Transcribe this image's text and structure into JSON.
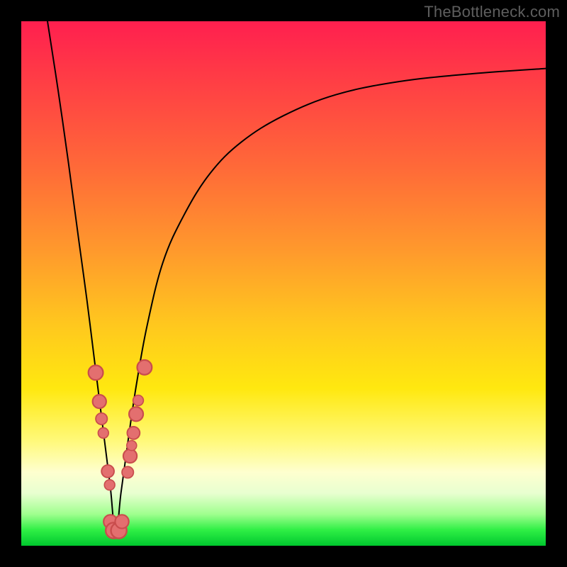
{
  "watermark": "TheBottleneck.com",
  "colors": {
    "frame": "#000000",
    "curve": "#000000",
    "bead_fill": "#e36f6f",
    "bead_stroke": "#c94d4d",
    "bead_stroke_wide": "#b94848"
  },
  "chart_data": {
    "type": "line",
    "title": "",
    "xlabel": "",
    "ylabel": "",
    "xlim": [
      0,
      100
    ],
    "ylim": [
      0,
      100
    ],
    "x_at_min": 18,
    "series": [
      {
        "name": "curve",
        "x": [
          5,
          7,
          9,
          11,
          12.5,
          14,
          15.5,
          17,
          18,
          19,
          20.5,
          22,
          24,
          27,
          31,
          36,
          42,
          50,
          60,
          72,
          86,
          100
        ],
        "y": [
          100,
          87,
          73,
          58,
          47,
          35,
          23,
          11,
          1.5,
          10,
          21,
          31,
          42,
          54,
          63,
          71,
          77,
          82,
          86,
          88.5,
          90,
          91
        ]
      }
    ],
    "beads": [
      {
        "x": 14.2,
        "y": 33,
        "r": 1.4
      },
      {
        "x": 14.9,
        "y": 27.5,
        "r": 1.3
      },
      {
        "x": 15.3,
        "y": 24.2,
        "r": 1.1
      },
      {
        "x": 15.65,
        "y": 21.5,
        "r": 1.0
      },
      {
        "x": 16.5,
        "y": 14.2,
        "r": 1.2
      },
      {
        "x": 16.85,
        "y": 11.6,
        "r": 1.0
      },
      {
        "x": 17.0,
        "y": 4.6,
        "r": 1.3
      },
      {
        "x": 17.6,
        "y": 2.9,
        "r": 1.5
      },
      {
        "x": 18.6,
        "y": 2.9,
        "r": 1.5
      },
      {
        "x": 19.2,
        "y": 4.6,
        "r": 1.3
      },
      {
        "x": 20.3,
        "y": 14.0,
        "r": 1.1
      },
      {
        "x": 20.75,
        "y": 17.1,
        "r": 1.3
      },
      {
        "x": 21.05,
        "y": 19.1,
        "r": 0.95
      },
      {
        "x": 21.4,
        "y": 21.5,
        "r": 1.2
      },
      {
        "x": 21.9,
        "y": 25.1,
        "r": 1.35
      },
      {
        "x": 22.3,
        "y": 27.7,
        "r": 1.0
      },
      {
        "x": 23.5,
        "y": 34.0,
        "r": 1.4
      }
    ]
  }
}
